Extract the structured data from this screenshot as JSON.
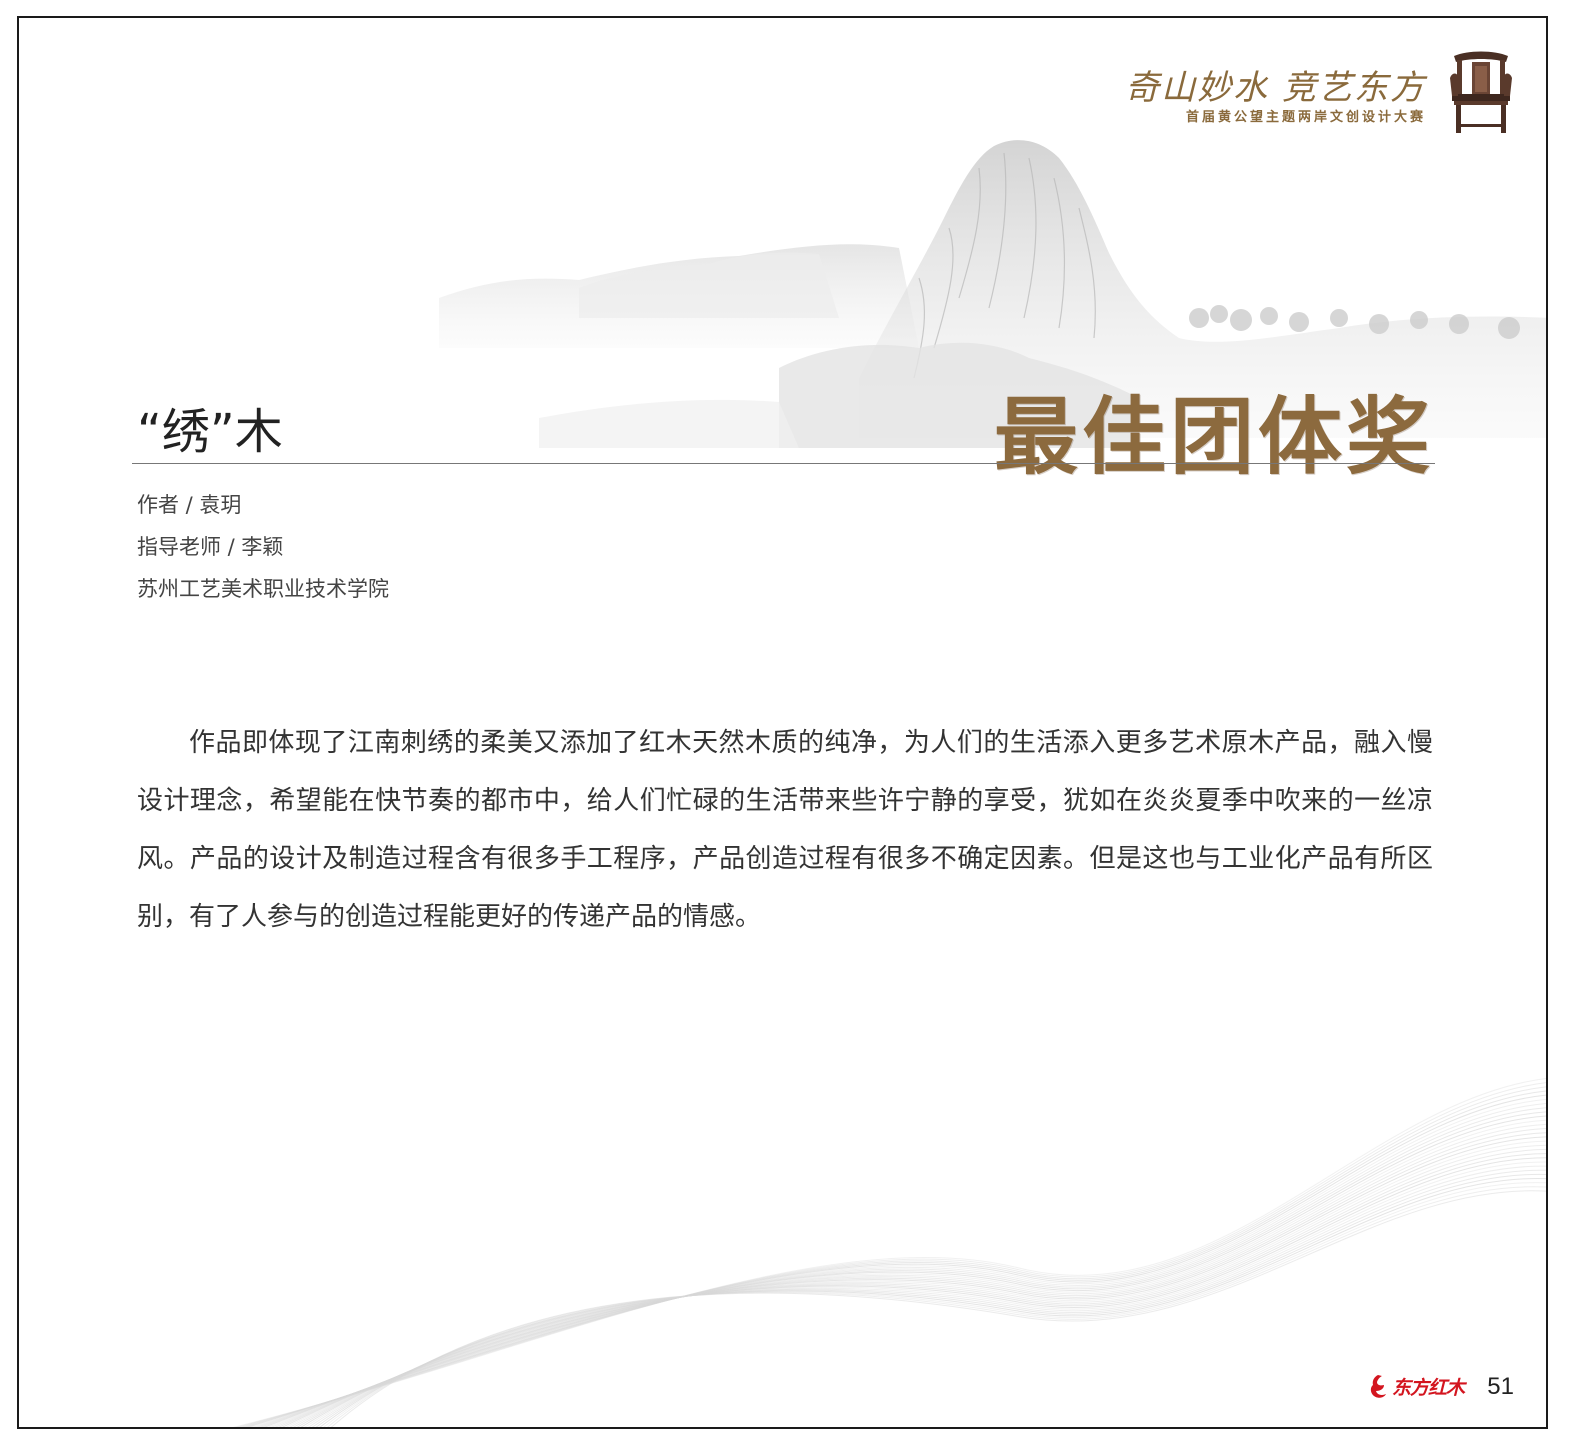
{
  "header": {
    "slogan": "奇山妙水 竞艺东方",
    "contest_name": "首届黄公望主题两岸文创设计大赛"
  },
  "award": {
    "title": "最佳团体奖"
  },
  "work": {
    "title": "“绣”木",
    "author": "作者 / 袁玥",
    "advisor": "指导老师 / 李颖",
    "school": "苏州工艺美术职业技术学院"
  },
  "description": "作品即体现了江南刺绣的柔美又添加了红木天然木质的纯净，为人们的生活添入更多艺术原木产品，融入慢设计理念，希望能在快节奏的都市中，给人们忙碌的生活带来些许宁静的享受，犹如在炎炎夏季中吹来的一丝凉风。产品的设计及制造过程含有很多手工程序，产品创造过程有很多不确定因素。但是这也与工业化产品有所区别，有了人参与的创造过程能更好的传递产品的情感。",
  "footer": {
    "brand": "东方红木",
    "page_number": "51"
  },
  "colors": {
    "accent_gold": "#8c6a3e",
    "brand_red": "#d3151f",
    "frame": "#1a1a1a"
  }
}
